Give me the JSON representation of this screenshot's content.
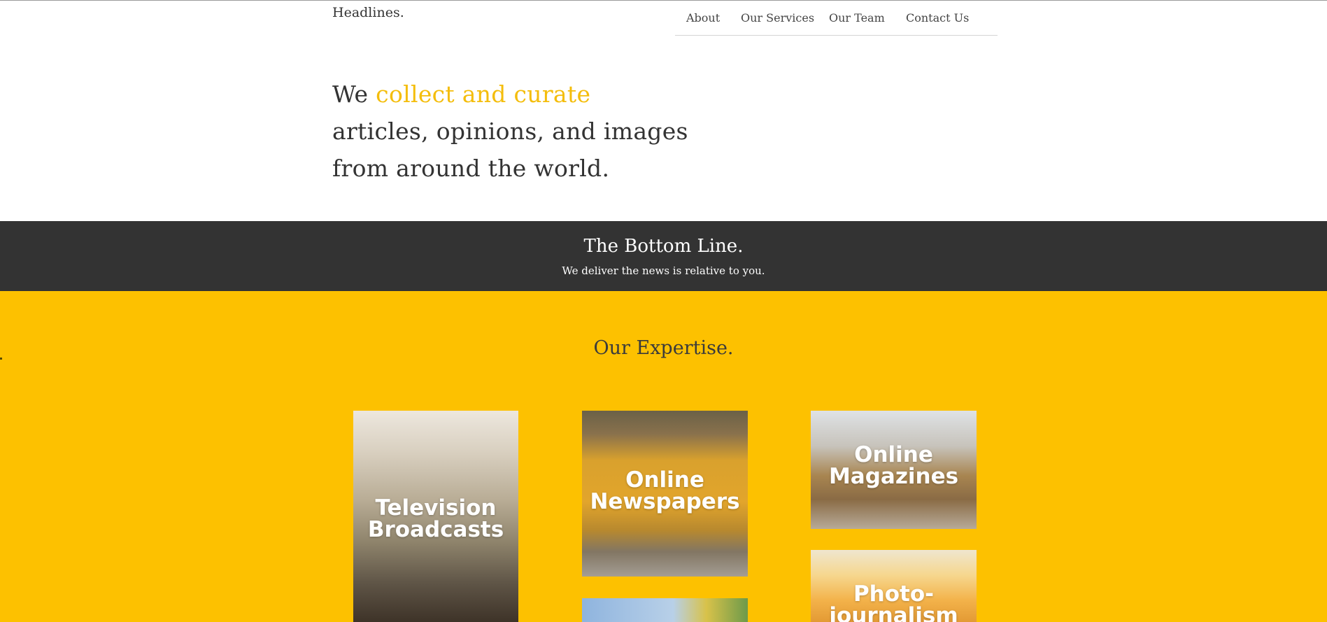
{
  "header": {
    "brand": "Headlines.",
    "nav": [
      "About",
      "Our Services",
      "Our Team",
      "Contact Us"
    ]
  },
  "hero": {
    "lead": "We ",
    "accent": "collect and curate",
    "line2": "articles, opinions, and images",
    "line3": "from around the world."
  },
  "bottom_line": {
    "title": "The Bottom Line.",
    "subtitle": "We deliver the news is relative to you."
  },
  "expertise": {
    "title": "Our Expertise.",
    "cards": [
      {
        "line1": "Television",
        "line2": "Broadcasts"
      },
      {
        "line1": "Online",
        "line2": "Newspapers"
      },
      {
        "line1": "Online",
        "line2": "Magazines"
      },
      {
        "line1": "Photo-",
        "line2": "journalism"
      }
    ]
  },
  "colors": {
    "accent": "#f4bd0b",
    "dark_band": "#333333",
    "expertise_bg": "#fdc100"
  }
}
